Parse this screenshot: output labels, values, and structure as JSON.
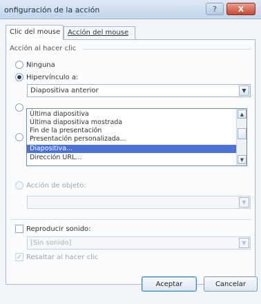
{
  "window": {
    "title": "onfiguración de la acción",
    "help_label": "?",
    "close_label": "X"
  },
  "tabs": [
    {
      "label": "Clic del mouse"
    },
    {
      "label": "Acción del mouse"
    }
  ],
  "section": {
    "label": "Acción al hacer clic"
  },
  "radios": {
    "ninguna": "Ninguna",
    "hipervinculo": "Hipervínculo a:",
    "accion_objeto": "Acción de objeto:"
  },
  "hyperlink_combo": {
    "value": "Diapositiva anterior"
  },
  "dropdown_list": {
    "items": [
      "Última diapositiva",
      "Última diapositiva mostrada",
      "Fin de la presentación",
      "Presentación personalizada...",
      "Diapositiva...",
      "Dirección URL..."
    ],
    "selected_index": 4
  },
  "object_action_combo": {
    "value": ""
  },
  "sound": {
    "label": "Reproducir sonido:",
    "value": "[Sin sonido]"
  },
  "highlight": {
    "label": "Resaltar al hacer clic"
  },
  "buttons": {
    "accept": "Aceptar",
    "cancel": "Cancelar"
  },
  "colors": {
    "selection": "#4c72d9",
    "close_button": "#c9482f"
  }
}
